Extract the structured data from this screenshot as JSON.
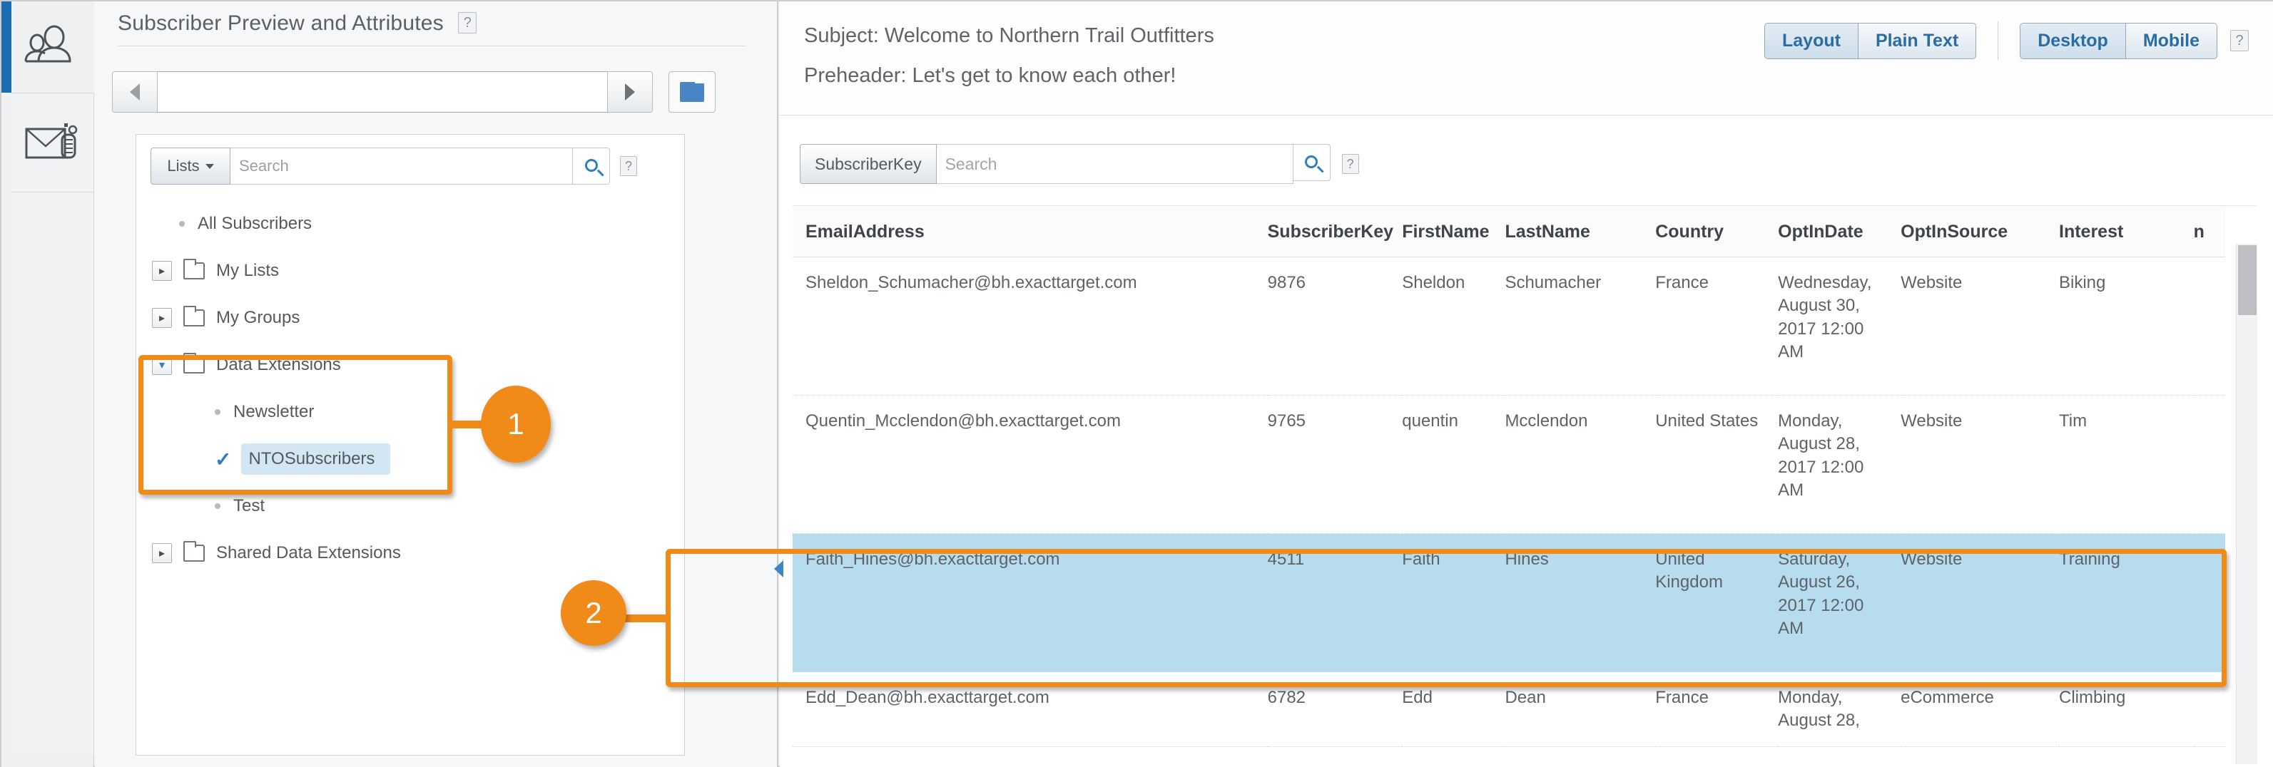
{
  "rail": {
    "items": [
      {
        "icon": "people-icon",
        "active": true
      },
      {
        "icon": "email-test-icon",
        "active": false
      }
    ]
  },
  "left_panel": {
    "title": "Subscriber Preview and Attributes",
    "help_label": "?",
    "nav": {
      "prev_icon": "chevron-left-icon",
      "next_icon": "chevron-right-icon",
      "path_value": "",
      "folder_icon": "folder-icon"
    },
    "tree_search": {
      "scope_label": "Lists",
      "placeholder": "Search",
      "value": "",
      "search_icon": "search-icon",
      "help_label": "?"
    },
    "tree": [
      {
        "label": "All Subscribers",
        "type": "leaf",
        "indent": 1,
        "selected": false
      },
      {
        "label": "My Lists",
        "type": "folder",
        "indent": 0,
        "expanded": false
      },
      {
        "label": "My Groups",
        "type": "folder",
        "indent": 0,
        "expanded": false
      },
      {
        "label": "Data Extensions",
        "type": "folder",
        "indent": 0,
        "expanded": true
      },
      {
        "label": "Newsletter",
        "type": "leaf",
        "indent": 2,
        "selected": false
      },
      {
        "label": "NTOSubscribers",
        "type": "leaf-checked",
        "indent": 2,
        "selected": true
      },
      {
        "label": "Test",
        "type": "leaf",
        "indent": 2,
        "selected": false
      },
      {
        "label": "Shared Data Extensions",
        "type": "folder",
        "indent": 0,
        "expanded": false
      }
    ]
  },
  "right_panel": {
    "subject": "Subject: Welcome to Northern Trail Outfitters",
    "preheader": "Preheader: Let's get to know each other!",
    "view_toggle": {
      "options": [
        "Layout",
        "Plain Text"
      ],
      "selected": "Layout"
    },
    "device_toggle": {
      "options": [
        "Desktop",
        "Mobile"
      ],
      "selected": "Desktop"
    },
    "help_label": "?",
    "grid_search": {
      "scope_label": "SubscriberKey",
      "placeholder": "Search",
      "value": "",
      "search_icon": "search-icon",
      "help_label": "?"
    },
    "grid": {
      "columns": [
        "EmailAddress",
        "SubscriberKey",
        "FirstName",
        "LastName",
        "Country",
        "OptInDate",
        "OptInSource",
        "Interest",
        "n"
      ],
      "rows": [
        {
          "highlighted": false,
          "cells": [
            "Sheldon_Schumacher@bh.exacttarget.com",
            "9876",
            "Sheldon",
            "Schumacher",
            "France",
            "Wednesday, August 30, 2017 12:00 AM",
            "Website",
            "Biking",
            ""
          ]
        },
        {
          "highlighted": false,
          "cells": [
            "Quentin_Mcclendon@bh.exacttarget.com",
            "9765",
            "quentin",
            "Mcclendon",
            "United States",
            "Monday, August 28, 2017 12:00 AM",
            "Website",
            "Tim",
            ""
          ]
        },
        {
          "highlighted": true,
          "cells": [
            "Faith_Hines@bh.exacttarget.com",
            "4511",
            "Faith",
            "Hines",
            "United Kingdom",
            "Saturday, August 26, 2017 12:00 AM",
            "Website",
            "Training",
            ""
          ]
        },
        {
          "highlighted": false,
          "cells": [
            "Edd_Dean@bh.exacttarget.com",
            "6782",
            "Edd",
            "Dean",
            "France",
            "Monday, August 28,",
            "eCommerce",
            "Climbing",
            ""
          ]
        }
      ]
    }
  },
  "callouts": [
    {
      "number": "1",
      "shape": "ellipse"
    },
    {
      "number": "2",
      "shape": "ellipse"
    }
  ],
  "colors": {
    "accent_orange": "#f08a18",
    "highlight_blue": "#b6dced",
    "active_rail": "#1c6cb2",
    "link_blue": "#2b6ca3"
  }
}
